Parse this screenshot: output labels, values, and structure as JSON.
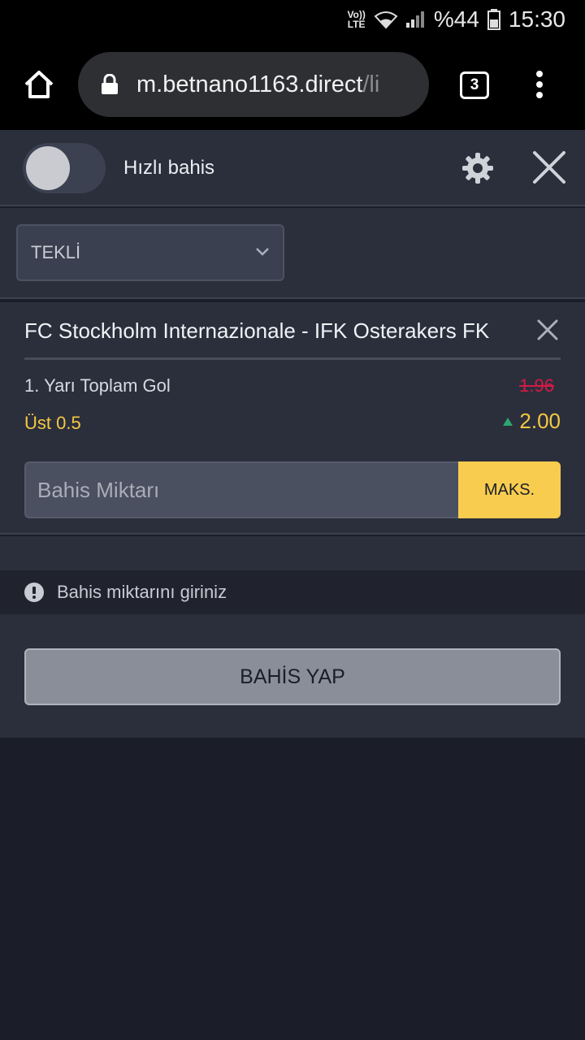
{
  "status_bar": {
    "volte": "Vo))",
    "lte": "LTE",
    "battery": "%44",
    "time": "15:30"
  },
  "browser": {
    "url_host": "m.betnano1163.direct",
    "url_path": "/li",
    "tab_count": "3"
  },
  "quick_bet": {
    "label": "Hızlı bahis",
    "enabled": false
  },
  "bet_type": {
    "selected": "TEKLİ"
  },
  "bet": {
    "match": "FC Stockholm Internazionale - IFK Osterakers FK",
    "market": "1. Yarı Toplam Gol",
    "old_odds": "1.96",
    "selection": "Üst 0.5",
    "new_odds": "2.00",
    "odds_direction": "up",
    "stake_placeholder": "Bahis Miktarı",
    "max_label": "MAKS."
  },
  "warning": {
    "text": "Bahis miktarını giriniz"
  },
  "place_bet": {
    "label": "BAHİS YAP"
  },
  "colors": {
    "accent": "#f8cd4f",
    "odds_old": "#d21b46",
    "odds_up": "#2ca66f",
    "panel": "#2b2f3c",
    "background": "#1b1e29"
  }
}
